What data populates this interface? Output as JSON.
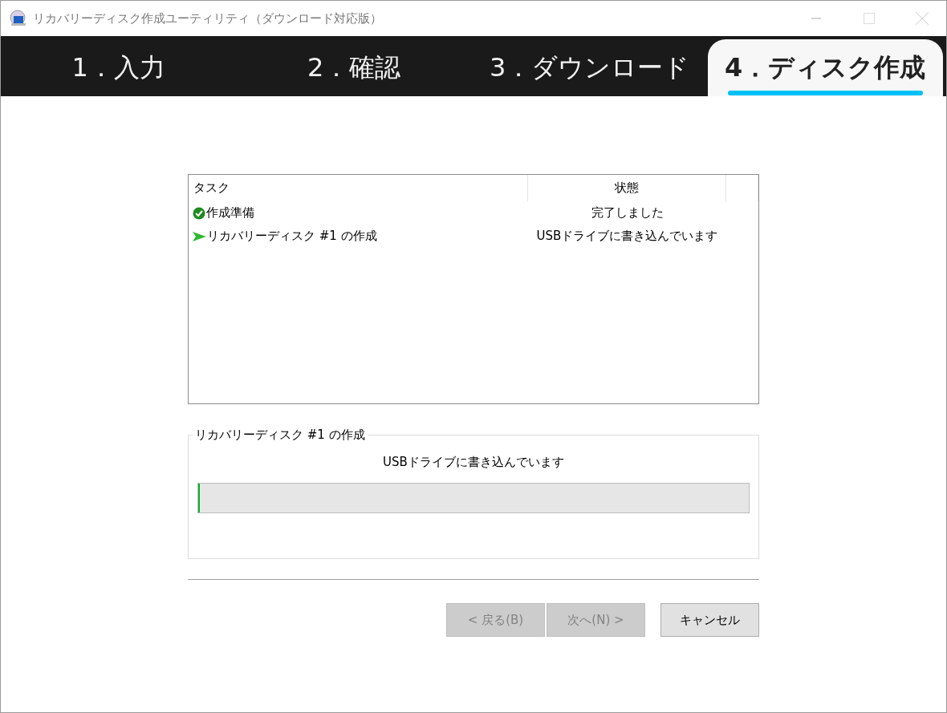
{
  "window": {
    "title": "リカバリーディスク作成ユーティリティ（ダウンロード対応版）"
  },
  "steps": [
    {
      "label": "1．入力",
      "selected": false
    },
    {
      "label": "2．確認",
      "selected": false
    },
    {
      "label": "3．ダウンロード",
      "selected": false
    },
    {
      "label": "4．ディスク作成",
      "selected": true
    }
  ],
  "task_list": {
    "columns": [
      "タスク",
      "状態"
    ],
    "rows": [
      {
        "task": "作成準備",
        "status": "完了しました",
        "kind": "done"
      },
      {
        "task": "リカバリーディスク #1 の作成",
        "status": "USBドライブに書き込んでいます",
        "kind": "running"
      }
    ]
  },
  "progress_group": {
    "title": "リカバリーディスク #1 の作成",
    "message": "USBドライブに書き込んでいます",
    "level": 0.002
  },
  "buttons": [
    {
      "label": "< 戻る(B)",
      "disabled": true
    },
    {
      "label": "次へ(N) >",
      "disabled": true
    },
    {
      "label": "キャンセル",
      "disabled": false
    }
  ]
}
